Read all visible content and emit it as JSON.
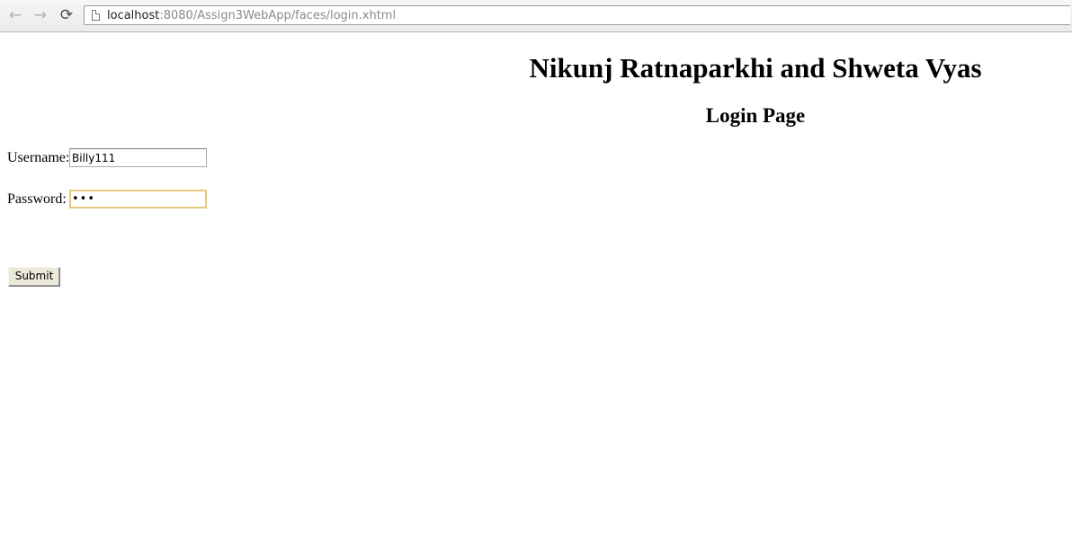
{
  "browser": {
    "url_host": "localhost",
    "url_rest": ":8080/Assign3WebApp/faces/login.xhtml",
    "back_glyph": "←",
    "forward_glyph": "→",
    "reload_glyph": "⟳",
    "icons": [
      "back-arrow-icon",
      "forward-arrow-icon",
      "reload-icon",
      "page-icon"
    ]
  },
  "page": {
    "title": "Nikunj Ratnaparkhi and Shweta Vyas",
    "subtitle": "Login Page"
  },
  "form": {
    "username_label": "Username:",
    "username_value": "Billy111",
    "password_label": "Password:",
    "password_display": "•••",
    "submit_label": "Submit",
    "focus_color": "#e5c97e"
  }
}
